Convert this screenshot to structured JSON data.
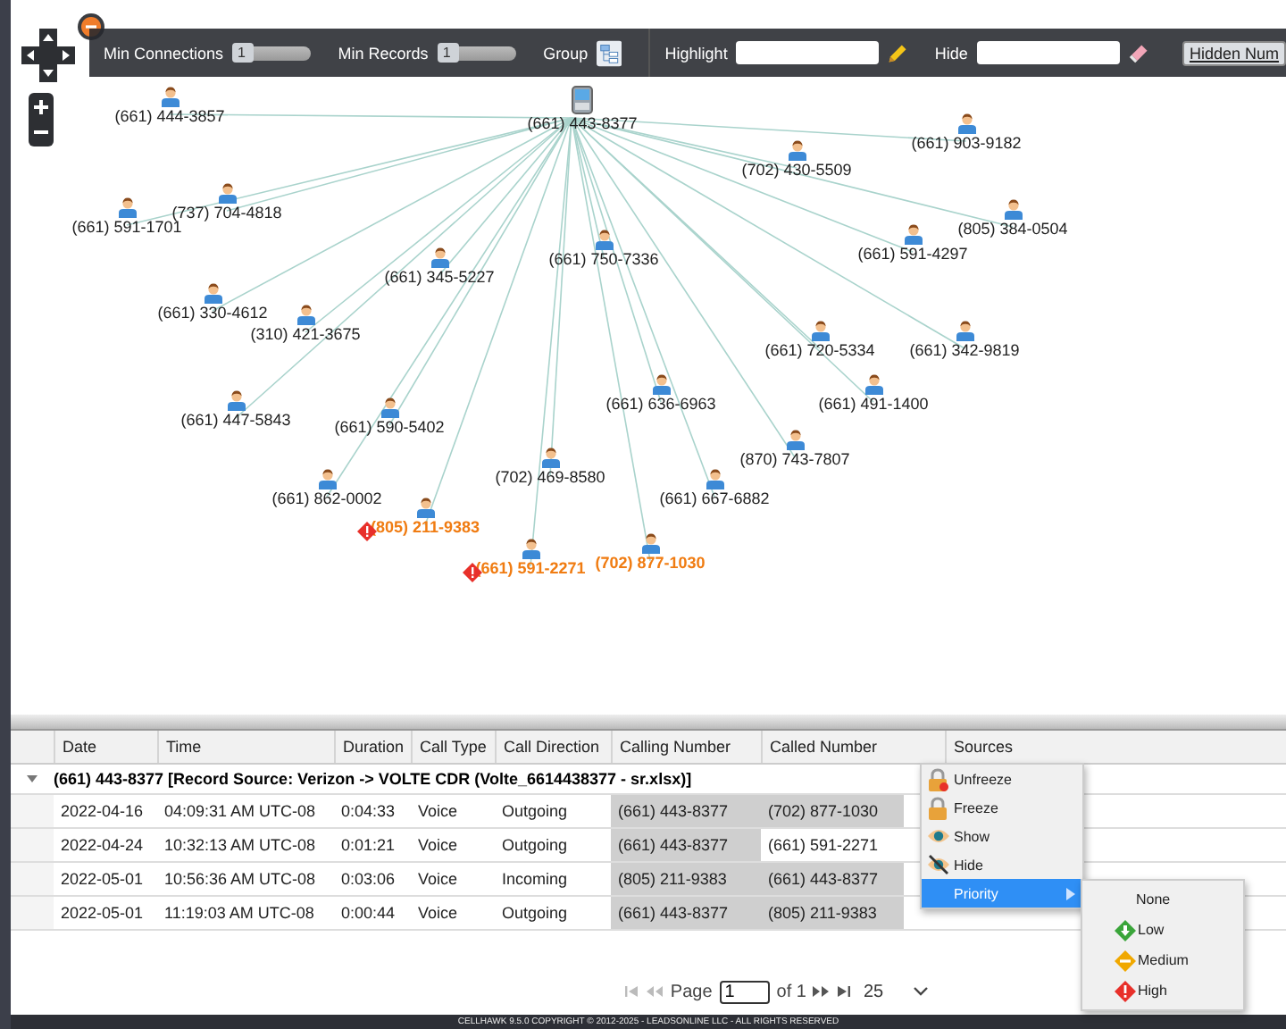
{
  "graph": {
    "center": {
      "label": "(661) 443-8377"
    },
    "nodes": [
      {
        "label": "(661) 444-3857",
        "flagged": false,
        "alert": false
      },
      {
        "label": "(661) 903-9182",
        "flagged": false,
        "alert": false
      },
      {
        "label": "(702) 430-5509",
        "flagged": false,
        "alert": false
      },
      {
        "label": "(737) 704-4818",
        "flagged": false,
        "alert": false
      },
      {
        "label": "(661) 591-1701",
        "flagged": false,
        "alert": false
      },
      {
        "label": "(805) 384-0504",
        "flagged": false,
        "alert": false
      },
      {
        "label": "(661) 750-7336",
        "flagged": false,
        "alert": false
      },
      {
        "label": "(661) 591-4297",
        "flagged": false,
        "alert": false
      },
      {
        "label": "(661) 345-5227",
        "flagged": false,
        "alert": false
      },
      {
        "label": "(661) 330-4612",
        "flagged": false,
        "alert": false
      },
      {
        "label": "(310) 421-3675",
        "flagged": false,
        "alert": false
      },
      {
        "label": "(661) 720-5334",
        "flagged": false,
        "alert": false
      },
      {
        "label": "(661) 342-9819",
        "flagged": false,
        "alert": false
      },
      {
        "label": "(661) 636-6963",
        "flagged": false,
        "alert": false
      },
      {
        "label": "(661) 491-1400",
        "flagged": false,
        "alert": false
      },
      {
        "label": "(661) 447-5843",
        "flagged": false,
        "alert": false
      },
      {
        "label": "(661) 590-5402",
        "flagged": false,
        "alert": false
      },
      {
        "label": "(870) 743-7807",
        "flagged": false,
        "alert": false
      },
      {
        "label": "(702) 469-8580",
        "flagged": false,
        "alert": false
      },
      {
        "label": "(661) 862-0002",
        "flagged": false,
        "alert": false
      },
      {
        "label": "(661) 667-6882",
        "flagged": false,
        "alert": false
      },
      {
        "label": "(805) 211-9383",
        "flagged": true,
        "alert": true
      },
      {
        "label": "(661) 591-2271",
        "flagged": true,
        "alert": true
      },
      {
        "label": "(702) 877-1030",
        "flagged": true,
        "alert": false
      }
    ]
  },
  "toolbar": {
    "min_connections": {
      "label": "Min Connections",
      "value": "1",
      "level": 0
    },
    "min_records": {
      "label": "Min Records",
      "value": "1",
      "level": 0
    },
    "group": {
      "label": "Group"
    },
    "highlight": {
      "label": "Highlight"
    },
    "hide": {
      "label": "Hide"
    },
    "hidden_numbers": {
      "label": "Hidden Num"
    }
  },
  "table": {
    "columns": [
      "Date",
      "Time",
      "Duration",
      "Call Type",
      "Call Direction",
      "Calling Number",
      "Called Number",
      "Sources"
    ],
    "group": {
      "label": "(661) 443-8377 [Record Source: Verizon -> VOLTE CDR (Volte_6614438377 - sr.xlsx)]",
      "expanded": true
    },
    "rows": [
      {
        "cells": [
          {
            "text": "2022-04-16"
          },
          {
            "text": "04:09:31 AM UTC-08"
          },
          {
            "text": "0:04:33"
          },
          {
            "text": "Voice"
          },
          {
            "text": "Outgoing"
          },
          {
            "text": "(661) 443-8377",
            "highlighted": true
          },
          {
            "text": "(702) 877-1030",
            "highlighted": true
          }
        ]
      },
      {
        "cells": [
          {
            "text": "2022-04-24"
          },
          {
            "text": "10:32:13 AM UTC-08"
          },
          {
            "text": "0:01:21"
          },
          {
            "text": "Voice"
          },
          {
            "text": "Outgoing"
          },
          {
            "text": "(661) 443-8377",
            "highlighted": true
          },
          {
            "text": "(661) 591-2271",
            "highlighted": false
          }
        ]
      },
      {
        "cells": [
          {
            "text": "2022-05-01"
          },
          {
            "text": "10:56:36 AM UTC-08"
          },
          {
            "text": "0:03:06"
          },
          {
            "text": "Voice"
          },
          {
            "text": "Incoming"
          },
          {
            "text": "(805) 211-9383",
            "highlighted": true
          },
          {
            "text": "(661) 443-8377",
            "highlighted": true
          }
        ]
      },
      {
        "cells": [
          {
            "text": "2022-05-01"
          },
          {
            "text": "11:19:03 AM UTC-08"
          },
          {
            "text": "0:00:44"
          },
          {
            "text": "Voice"
          },
          {
            "text": "Outgoing"
          },
          {
            "text": "(661) 443-8377",
            "highlighted": true
          },
          {
            "text": "(805) 211-9383",
            "highlighted": true
          }
        ]
      }
    ]
  },
  "context_menu": {
    "items": [
      {
        "kind": "unfreeze",
        "label": "Unfreeze",
        "selected": false
      },
      {
        "kind": "freeze",
        "label": "Freeze",
        "selected": false
      },
      {
        "kind": "show",
        "label": "Show",
        "selected": false
      },
      {
        "kind": "hide",
        "label": "Hide",
        "selected": false
      },
      {
        "kind": "priority",
        "label": "Priority",
        "selected": true
      }
    ],
    "submenu": [
      {
        "kind": "none",
        "label": "None"
      },
      {
        "kind": "low",
        "label": "Low"
      },
      {
        "kind": "medium",
        "label": "Medium"
      },
      {
        "kind": "high",
        "label": "High"
      }
    ]
  },
  "pager": {
    "page_label": "Page",
    "page": "1",
    "of_label": "of 1",
    "page_size": "25"
  },
  "footer": "CELLHAWK 9.5.0 COPYRIGHT © 2012-2025 - LEADSONLINE LLC - ALL RIGHTS RESERVED"
}
